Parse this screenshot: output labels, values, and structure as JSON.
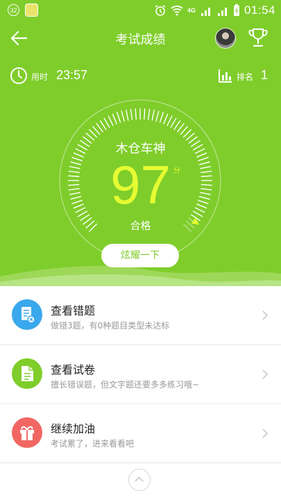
{
  "status_bar": {
    "badge_count": "32",
    "network_label": "4G",
    "network_sub1": "4G",
    "network_sub2": "2G",
    "time": "01:54"
  },
  "header": {
    "title": "考试成绩",
    "back_icon": "arrow-left-icon",
    "trophy_icon": "trophy-icon"
  },
  "stats": {
    "time_label": "用时",
    "time_value": "23:57",
    "rank_label": "排名",
    "rank_value": "1"
  },
  "result": {
    "title_name": "木仓车神",
    "score": "97",
    "unit": "分",
    "status": "合格",
    "score_fraction": 0.97,
    "show_off_button": "炫耀一下"
  },
  "menu": [
    {
      "title": "查看错题",
      "subtitle": "做错3题，有0种题目类型未达标",
      "icon": "wrong-questions-icon",
      "color": "#3aa8ec"
    },
    {
      "title": "查看试卷",
      "subtitle": "擅长错误题，但文字题还要多多练习哦~",
      "icon": "document-icon",
      "color": "#7fcd2b"
    },
    {
      "title": "继续加油",
      "subtitle": "考试累了，进来看看吧",
      "icon": "gift-icon",
      "color": "#f26763"
    }
  ],
  "colors": {
    "primary_green": "#7fcd2b",
    "score_yellow": "#e5fb33"
  }
}
